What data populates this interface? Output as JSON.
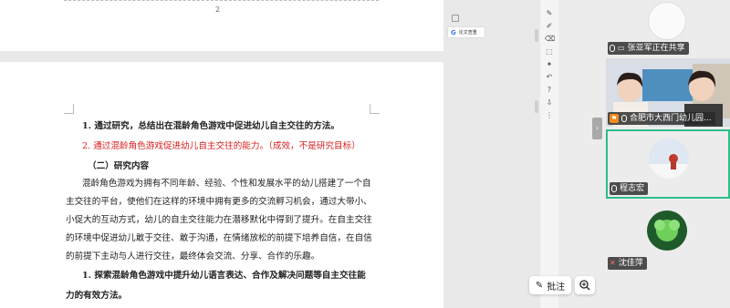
{
  "document": {
    "page_number": "2",
    "lines": [
      {
        "text": "1. 通过研究，总结出在混龄角色游戏中促进幼儿自主交往的方法。",
        "style": "bold"
      },
      {
        "text": "2. 通过混龄角色游戏促进幼儿自主交往的能力。（成效，不是研究目标）",
        "style": "red"
      },
      {
        "text": "（二）研究内容",
        "style": "bold"
      },
      {
        "text": "混龄角色游戏为拥有不同年龄、经验、个性和发展水平的幼儿搭建了一个自",
        "style": "normal"
      },
      {
        "text": "主交往的平台，使他们在这样的环境中拥有更多的交流孵习机会，通过大带小、",
        "style": "normal"
      },
      {
        "text": "小促大的互动方式，幼儿的自主交往能力在潜移默化中得到了提升。在自主交往",
        "style": "normal"
      },
      {
        "text": "的环境中促进幼儿敢于交往、敢于沟通，在情绪放松的前提下培养自信，在自信",
        "style": "normal"
      },
      {
        "text": "的前提下主动与人进行交往，最终体会交流、分享、合作的乐趣。",
        "style": "normal"
      },
      {
        "text": "1. 探索混龄角色游戏中提升幼儿语言表达、合作及解决问题等自主交往能",
        "style": "bold"
      },
      {
        "text": "力的有效方法。",
        "style": "bold"
      }
    ]
  },
  "comment_chip": {
    "icon": "G",
    "label": "论文查重"
  },
  "buttons": {
    "annotate_label": "批注"
  },
  "participants": [
    {
      "name": "张亚军正在共享",
      "badge": "mic"
    },
    {
      "name": "合肥市大西门幼儿园...",
      "badge": "presenter"
    },
    {
      "name": "程志宏",
      "badge": "mic"
    },
    {
      "name": "沈佳萍",
      "badge": "mic-off"
    }
  ],
  "colors": {
    "accent_red": "#d92020",
    "active_tile_border": "#2bbf88",
    "presenter_badge": "#f08b1d"
  }
}
